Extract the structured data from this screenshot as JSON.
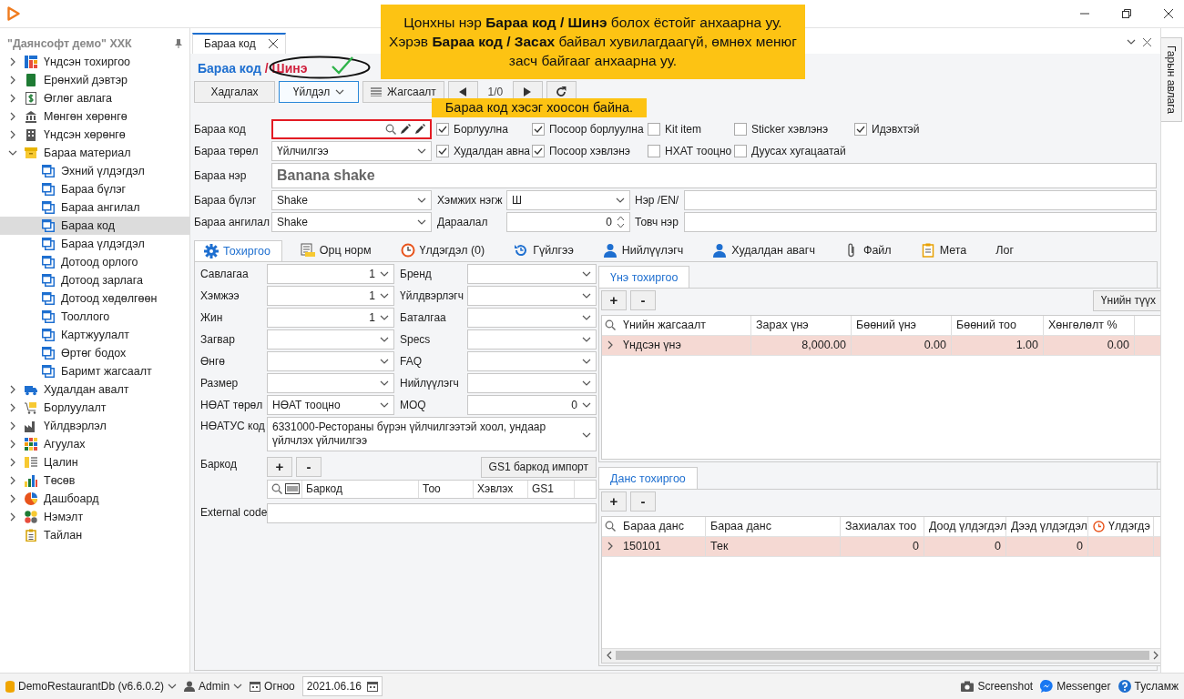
{
  "sidebar": {
    "company": "\"Даянсофт демо\" ХХК",
    "items": [
      {
        "label": "Үндсэн тохиргоо",
        "expanded": false,
        "selected": false
      },
      {
        "label": "Ерөнхий дэвтэр",
        "expanded": false,
        "selected": false
      },
      {
        "label": "Өглөг авлага",
        "expanded": false,
        "selected": false
      },
      {
        "label": "Мөнгөн хөрөнгө",
        "expanded": false,
        "selected": false
      },
      {
        "label": "Үндсэн хөрөнгө",
        "expanded": false,
        "selected": false
      },
      {
        "label": "Бараа материал",
        "expanded": true,
        "selected": false,
        "children": [
          {
            "label": "Эхний үлдэгдэл",
            "selected": false
          },
          {
            "label": "Бараа бүлэг",
            "selected": false
          },
          {
            "label": "Бараа ангилал",
            "selected": false
          },
          {
            "label": "Бараа код",
            "selected": true
          },
          {
            "label": "Бараа үлдэгдэл",
            "selected": false
          },
          {
            "label": "Дотоод орлого",
            "selected": false
          },
          {
            "label": "Дотоод зарлага",
            "selected": false
          },
          {
            "label": "Дотоод хөдөлгөөн",
            "selected": false
          },
          {
            "label": "Тооллого",
            "selected": false
          },
          {
            "label": "Картжуулалт",
            "selected": false
          },
          {
            "label": "Өртөг бодох",
            "selected": false
          },
          {
            "label": "Баримт жагсаалт",
            "selected": false
          }
        ]
      },
      {
        "label": "Худалдан авалт",
        "expanded": false,
        "selected": false
      },
      {
        "label": "Борлуулалт",
        "expanded": false,
        "selected": false
      },
      {
        "label": "Үйлдвэрлэл",
        "expanded": false,
        "selected": false
      },
      {
        "label": "Агуулах",
        "expanded": false,
        "selected": false
      },
      {
        "label": "Цалин",
        "expanded": false,
        "selected": false
      },
      {
        "label": "Төсөв",
        "expanded": false,
        "selected": false
      },
      {
        "label": "Дашбоард",
        "expanded": false,
        "selected": false
      },
      {
        "label": "Нэмэлт",
        "expanded": false,
        "selected": false
      },
      {
        "label": "Тайлан",
        "selected": false
      }
    ]
  },
  "document_tabs": [
    {
      "label": "Бараа код",
      "selected": true
    }
  ],
  "heading": {
    "entity": "Бараа код",
    "mode": "/ Шинэ"
  },
  "toolbar": {
    "buttons": [
      {
        "label": "Хадгалах",
        "kind": "plain"
      },
      {
        "label": "Үйлдэл",
        "kind": "dropdown"
      },
      {
        "label": "Жагсаалт",
        "kind": "list"
      }
    ],
    "position": "1/0"
  },
  "callouts": [
    {
      "text": "Цонхны нэр **Бараа код / Шинэ** болох ёстойг анхаарна уу. Хэрэв **Бараа код / Засах** байвал хувилагдаагүй, өмнөх менюг засч байгааг анхаарна уу."
    },
    {
      "text": "Бараа код хэсэг хоосон байна."
    }
  ],
  "form": {
    "code": {
      "label": "Бараа код",
      "invalid": true
    },
    "type": {
      "label": "Бараа төрөл",
      "value": "Үйлчилгээ"
    },
    "flag_rows": [
      [
        {
          "label": "Борлуулна",
          "checked": true
        },
        {
          "label": "Посоор борлуулна",
          "checked": true
        },
        {
          "label": "Kit item",
          "checked": false
        },
        {
          "label": "Sticker хэвлэнэ",
          "checked": false
        },
        {
          "label": "Идэвхтэй",
          "checked": true
        }
      ],
      [
        {
          "label": "Худалдан авна",
          "checked": true
        },
        {
          "label": "Посоор хэвлэнэ",
          "checked": true
        },
        {
          "label": "НХАТ тооцно",
          "checked": false
        },
        {
          "label": "Дуусах хугацаатай",
          "checked": false
        }
      ]
    ],
    "name": {
      "label": "Бараа нэр",
      "value": "Banana shake"
    },
    "group": {
      "label": "Бараа бүлэг",
      "value": "Shake"
    },
    "unit": {
      "label": "Хэмжих нэгж",
      "value": "Ш"
    },
    "name_en": {
      "label": "Нэр /EN/"
    },
    "category": {
      "label": "Бараа ангилал",
      "value": "Shake"
    },
    "order": {
      "label": "Дараалал",
      "value": "0"
    },
    "short_name": {
      "label": "Товч нэр"
    }
  },
  "detail_tabs": [
    {
      "label": "Тохиргоо",
      "selected": true
    },
    {
      "label": "Орц норм",
      "selected": false
    },
    {
      "label": "Үлдэгдэл (0)",
      "selected": false
    },
    {
      "label": "Гүйлгээ",
      "selected": false
    },
    {
      "label": "Нийлүүлэгч",
      "selected": false
    },
    {
      "label": "Худалдан авагч",
      "selected": false
    },
    {
      "label": "Файл",
      "selected": false
    },
    {
      "label": "Мета",
      "selected": false
    },
    {
      "label": "Лог",
      "selected": false
    }
  ],
  "settings": [
    {
      "left": {
        "label": "Савлагаа",
        "value": "1",
        "kind": "number"
      },
      "right": {
        "label": "Бренд"
      }
    },
    {
      "left": {
        "label": "Хэмжээ",
        "value": "1",
        "kind": "number"
      },
      "right": {
        "label": "Үйлдвэрлэгч"
      }
    },
    {
      "left": {
        "label": "Жин",
        "value": "1",
        "kind": "number"
      },
      "right": {
        "label": "Баталгаа"
      }
    },
    {
      "left": {
        "label": "Загвар"
      },
      "right": {
        "label": "Specs"
      }
    },
    {
      "left": {
        "label": "Өнгө"
      },
      "right": {
        "label": "FAQ"
      }
    },
    {
      "left": {
        "label": "Размер"
      },
      "right": {
        "label": "Нийлүүлэгч"
      }
    },
    {
      "left": {
        "label": "НӨАТ төрөл",
        "value": "НӨАТ тооцно",
        "kind": "text"
      },
      "right": {
        "label": "MOQ",
        "value": "0",
        "kind": "number"
      }
    }
  ],
  "vat_code": {
    "label": "НӨАТУС код",
    "value": "6331000-Рестораны бүрэн үйлчилгээтэй хоол, ундаар үйлчлэх үйлчилгээ"
  },
  "barcode": {
    "label": "Баркод",
    "buttons": [
      "+",
      "-"
    ],
    "import_button": "GS1 баркод импорт",
    "columns": [
      "Баркод",
      "Тоо",
      "Хэвлэх",
      "GS1"
    ]
  },
  "external_code": {
    "label": "External code"
  },
  "price_panel": {
    "title": "Үнэ тохиргоо",
    "buttons": [
      "+",
      "-"
    ],
    "history_button": "Үнийн түүх",
    "columns": [
      "Үнийн жагсаалт",
      "Зарах үнэ",
      "Бөөний үнэ",
      "Бөөний тоо",
      "Хөнгөлөлт %"
    ],
    "rows": [
      {
        "cells": [
          "Үндсэн үнэ",
          "8,000.00",
          "0.00",
          "1.00",
          "0.00"
        ],
        "selected": true
      }
    ]
  },
  "account_panel": {
    "title": "Данс тохиргоо",
    "buttons": [
      "+",
      "-"
    ],
    "columns": [
      "Бараа данс",
      "Бараа данс",
      "Захиалах тоо",
      "Доод үлдэгдэл",
      "Дээд үлдэгдэл",
      "Үлдэгдэ"
    ],
    "rows": [
      {
        "cells": [
          "150101",
          "Тек",
          "0",
          "0",
          "0",
          null
        ],
        "selected": true
      }
    ]
  },
  "side_tab": {
    "label": "Гарын авлага"
  },
  "status_bar": {
    "database": "DemoRestaurantDb (v6.6.0.2)",
    "user": "Admin",
    "date_label": "Огноо",
    "date": "2021.06.16",
    "links": [
      "Screenshot",
      "Messenger",
      "Тусламж"
    ]
  }
}
